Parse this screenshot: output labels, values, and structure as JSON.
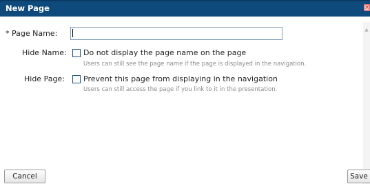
{
  "dialog": {
    "title": "New Page",
    "close_icon": "×"
  },
  "form": {
    "page_name_label": "* Page Name:",
    "page_name_value": "",
    "hide_name_label": "Hide Name:",
    "hide_name_option": "Do not display the page name on the page",
    "hide_name_hint": "Users can still see the page name if the page is displayed in the navigation.",
    "hide_name_checked": false,
    "hide_page_label": "Hide Page:",
    "hide_page_option": "Prevent this page from displaying in the navigation",
    "hide_page_hint": "Users can still access the page if you link to it in the presentation.",
    "hide_page_checked": false
  },
  "buttons": {
    "cancel": "Cancel",
    "save": "Save"
  },
  "icons": {
    "close": "close-icon",
    "scroll_up": "chevron-up-icon",
    "scroll_down": "chevron-down-icon"
  },
  "colors": {
    "titlebar": "#0e4a7c",
    "checkbox_border": "#1c5180",
    "hint_text": "#8a8a8a"
  }
}
